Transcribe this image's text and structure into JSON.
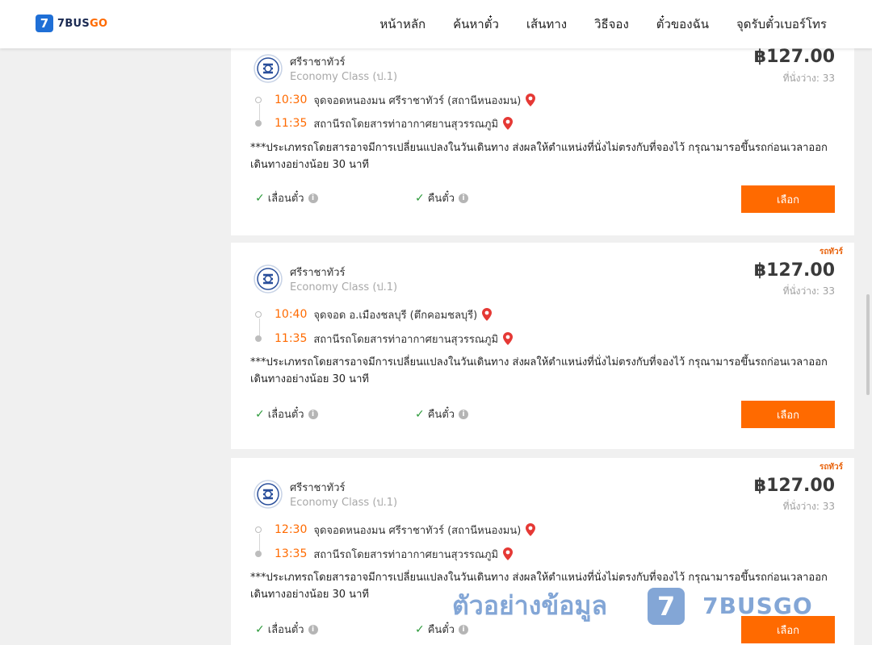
{
  "brand": {
    "badge": "7",
    "name_main": "7BUS",
    "name_accent": "GO"
  },
  "nav": [
    "หน้าหลัก",
    "ค้นหาตั๋ว",
    "เส้นทาง",
    "วิธีจอง",
    "ตั๋วของฉัน",
    "จุดรับตั๋วเบอร์โทร"
  ],
  "colors": {
    "accent": "#ff6a00",
    "brand_blue": "#1f6fd6",
    "check_green": "#2c9a3a"
  },
  "trips": [
    {
      "tag": "",
      "operator": "ศรีราชาทัวร์",
      "class": "Economy Class (ป.1)",
      "price": "฿127.00",
      "seats": "ที่นั่งว่าง: 33",
      "depart_time": "10:30",
      "depart_place": "จุดจอดหนองมน ศรีราชาทัวร์ (สถานีหนองมน)",
      "arrive_time": "11:35",
      "arrive_place": "สถานีรถโดยสารท่าอากาศยานสุวรรณภูมิ",
      "note": "***ประเภทรถโดยสารอาจมีการเปลี่ยนแปลงในวันเดินทาง ส่งผลให้ตำแหน่งที่นั่งไม่ตรงกับที่จองไว้ กรุณามารอขึ้นรถก่อนเวลาออกเดินทางอย่างน้อย 30 นาที",
      "feature1": "เลื่อนตั๋ว",
      "feature2": "คืนตั๋ว",
      "button": "เลือก"
    },
    {
      "tag": "รถทัวร์",
      "operator": "ศรีราชาทัวร์",
      "class": "Economy Class (ป.1)",
      "price": "฿127.00",
      "seats": "ที่นั่งว่าง: 33",
      "depart_time": "10:40",
      "depart_place": "จุดจอด อ.เมืองชลบุรี (ตึกคอมชลบุรี)",
      "arrive_time": "11:35",
      "arrive_place": "สถานีรถโดยสารท่าอากาศยานสุวรรณภูมิ",
      "note": "***ประเภทรถโดยสารอาจมีการเปลี่ยนแปลงในวันเดินทาง ส่งผลให้ตำแหน่งที่นั่งไม่ตรงกับที่จองไว้ กรุณามารอขึ้นรถก่อนเวลาออกเดินทางอย่างน้อย 30 นาที",
      "feature1": "เลื่อนตั๋ว",
      "feature2": "คืนตั๋ว",
      "button": "เลือก"
    },
    {
      "tag": "รถทัวร์",
      "operator": "ศรีราชาทัวร์",
      "class": "Economy Class (ป.1)",
      "price": "฿127.00",
      "seats": "ที่นั่งว่าง: 33",
      "depart_time": "12:30",
      "depart_place": "จุดจอดหนองมน ศรีราชาทัวร์ (สถานีหนองมน)",
      "arrive_time": "13:35",
      "arrive_place": "สถานีรถโดยสารท่าอากาศยานสุวรรณภูมิ",
      "note": "***ประเภทรถโดยสารอาจมีการเปลี่ยนแปลงในวันเดินทาง ส่งผลให้ตำแหน่งที่นั่งไม่ตรงกับที่จองไว้ กรุณามารอขึ้นรถก่อนเวลาออกเดินทางอย่างน้อย 30 นาที",
      "feature1": "เลื่อนตั๋ว",
      "feature2": "คืนตั๋ว",
      "button": "เลือก"
    }
  ],
  "watermark": {
    "text": "ตัวอย่างข้อมูล",
    "badge": "7",
    "brand": "7BUSGO"
  }
}
